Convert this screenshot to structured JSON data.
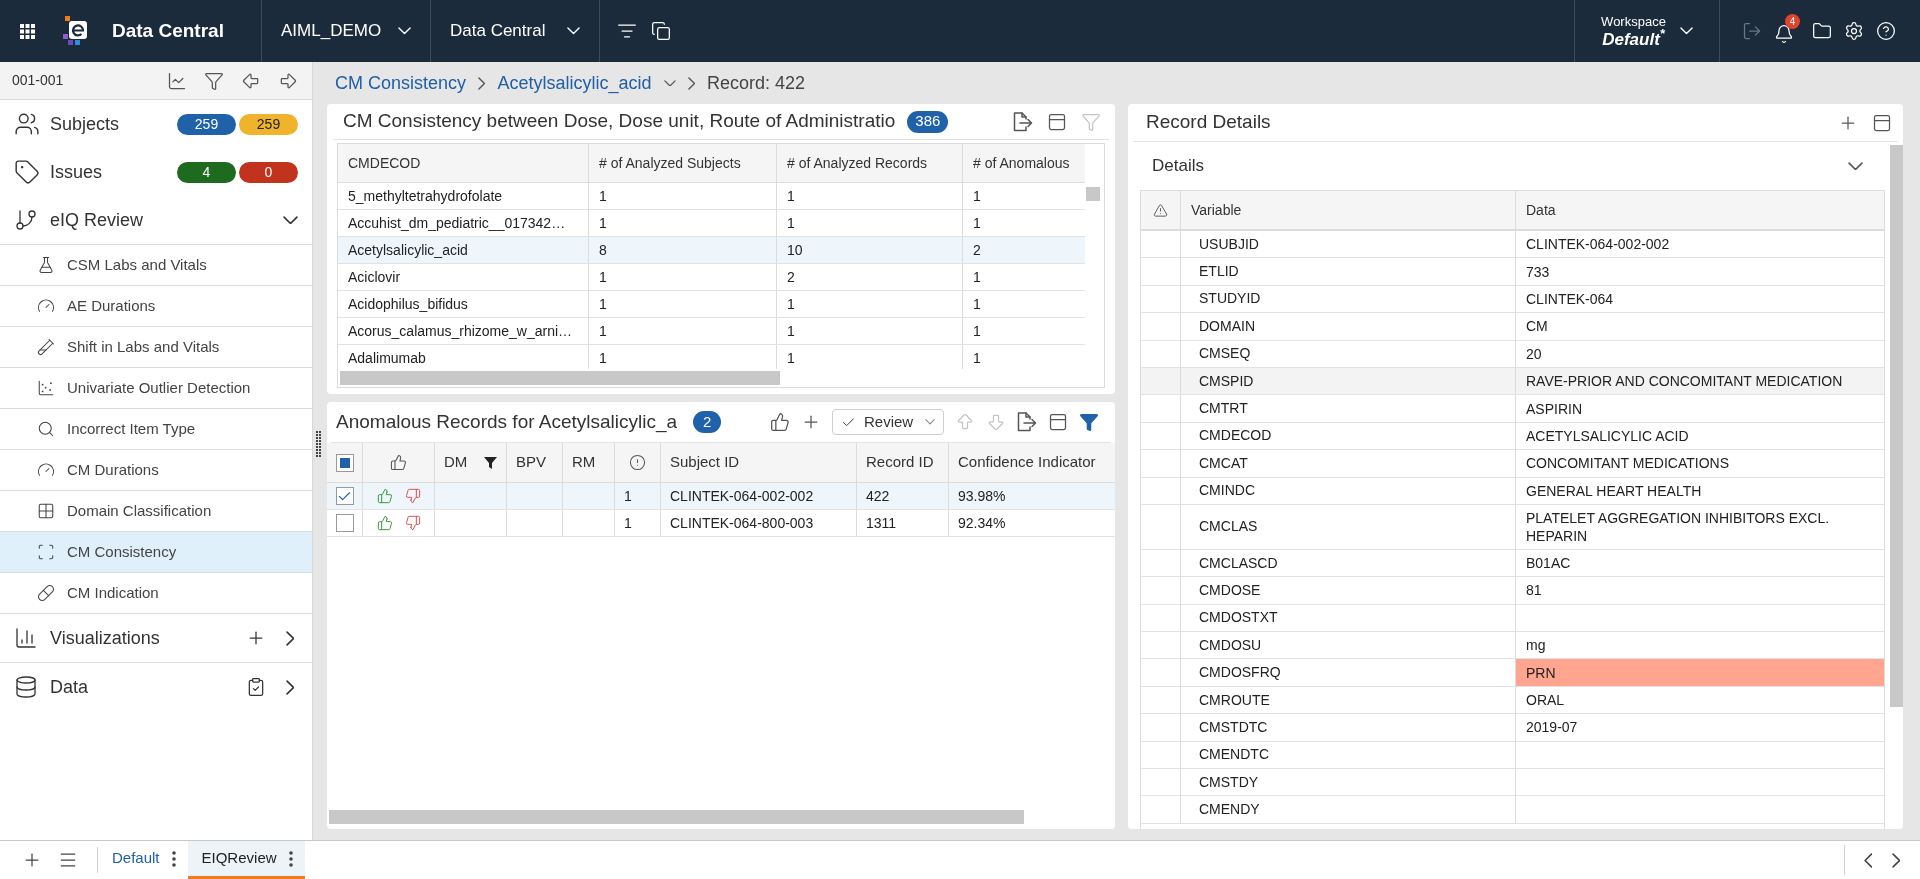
{
  "topbar": {
    "title": "Data Central",
    "menus": [
      {
        "label": "AIML_DEMO"
      },
      {
        "label": "Data Central"
      }
    ],
    "workspace": {
      "label": "Workspace",
      "value": "Default$^{*}$"
    },
    "export_disabled": true,
    "notification_count": "4"
  },
  "sidebar": {
    "header": "001-001",
    "counters": [
      {
        "label": "Subjects",
        "badges": [
          {
            "value": "259",
            "color": "#1f62aa"
          },
          {
            "value": "259",
            "color": "#f0b32c"
          }
        ]
      },
      {
        "label": "Issues",
        "badges": [
          {
            "value": "4",
            "color": "#1e6a1e"
          },
          {
            "value": "0",
            "color": "#c2331d"
          }
        ]
      }
    ],
    "sections": [
      {
        "label": "eIQ Review",
        "expanded": true,
        "children": [
          {
            "label": "CSM Labs and Vitals",
            "selected": false
          },
          {
            "label": "AE Durations",
            "selected": false
          },
          {
            "label": "Shift in Labs and Vitals",
            "selected": false
          },
          {
            "label": "Univariate Outlier Detection",
            "selected": false
          },
          {
            "label": "Incorrect Item Type",
            "selected": false
          },
          {
            "label": "CM Durations",
            "selected": false
          },
          {
            "label": "Domain Classification",
            "selected": false
          },
          {
            "label": "CM Consistency",
            "selected": true
          },
          {
            "label": "CM Indication",
            "selected": false
          }
        ]
      },
      {
        "label": "Visualizations",
        "expanded": false
      },
      {
        "label": "Data",
        "expanded": false
      }
    ]
  },
  "breadcrumb": [
    {
      "kind": "link",
      "label": "CM Consistency"
    },
    {
      "kind": "dropdown",
      "label": "Acetylsalicylic_acid"
    },
    {
      "kind": "current",
      "label": "Record: 422"
    }
  ],
  "consistency_panel": {
    "title": "CM Consistency between Dose, Dose unit, Route of Administratio",
    "count": "386",
    "filter_active": false,
    "columns": [
      "CMDECOD",
      "# of Analyzed Subjects",
      "# of Analyzed Records",
      "# of Anomalous"
    ],
    "rows": [
      {
        "cells": [
          "5_methyltetrahydrofolate",
          "1",
          "1",
          "1"
        ],
        "selected": false
      },
      {
        "cells": [
          "Accuhist_dm_pediatric__017342…",
          "1",
          "1",
          "1"
        ],
        "selected": false
      },
      {
        "cells": [
          "Acetylsalicylic_acid",
          "8",
          "10",
          "2"
        ],
        "selected": true
      },
      {
        "cells": [
          "Aciclovir",
          "1",
          "2",
          "1"
        ],
        "selected": false
      },
      {
        "cells": [
          "Acidophilus_bifidus",
          "1",
          "1",
          "1"
        ],
        "selected": false
      },
      {
        "cells": [
          "Acorus_calamus_rhizome_w_arni…",
          "1",
          "1",
          "1"
        ],
        "selected": false
      },
      {
        "cells": [
          "Adalimumab",
          "1",
          "1",
          "1"
        ],
        "selected": false
      }
    ]
  },
  "anomalous_panel": {
    "title": "Anomalous Records for Acetylsalicylic_a",
    "count": "2",
    "review_button": "Review",
    "move_up_disabled": true,
    "move_down_disabled": true,
    "filter_active": true,
    "columns": [
      {
        "kind": "checkbox",
        "indeterminate": true
      },
      {
        "kind": "vote"
      },
      {
        "kind": "text",
        "label": "DM",
        "filtered": true
      },
      {
        "kind": "text",
        "label": "BPV",
        "filtered": false
      },
      {
        "kind": "text",
        "label": "RM",
        "filtered": false
      },
      {
        "kind": "flag"
      },
      {
        "kind": "text",
        "label": "Subject ID",
        "filtered": false
      },
      {
        "kind": "text",
        "label": "Record ID",
        "filtered": false
      },
      {
        "kind": "text",
        "label": "Confidence Indicator",
        "filtered": false
      }
    ],
    "rows": [
      {
        "checked": true,
        "selected": true,
        "flag_count": "1",
        "subject_id": "CLINTEK-064-002-002",
        "record_id": "422",
        "confidence": "93.98%"
      },
      {
        "checked": false,
        "selected": false,
        "flag_count": "1",
        "subject_id": "CLINTEK-064-800-003",
        "record_id": "1311",
        "confidence": "92.34%"
      }
    ]
  },
  "record_details": {
    "title": "Record Details",
    "section": {
      "label": "Details",
      "expanded": true
    },
    "columns": [
      "Variable",
      "Data"
    ],
    "rows": [
      {
        "variable": "USUBJID",
        "data": "CLINTEK-064-002-002",
        "hovered": false,
        "flagged": false
      },
      {
        "variable": "ETLID",
        "data": "733",
        "hovered": false,
        "flagged": false
      },
      {
        "variable": "STUDYID",
        "data": "CLINTEK-064",
        "hovered": false,
        "flagged": false
      },
      {
        "variable": "DOMAIN",
        "data": "CM",
        "hovered": false,
        "flagged": false
      },
      {
        "variable": "CMSEQ",
        "data": "20",
        "hovered": false,
        "flagged": false
      },
      {
        "variable": "CMSPID",
        "data": "RAVE-PRIOR AND CONCOMITANT MEDICATION",
        "hovered": true,
        "flagged": false
      },
      {
        "variable": "CMTRT",
        "data": "ASPIRIN",
        "hovered": false,
        "flagged": false
      },
      {
        "variable": "CMDECOD",
        "data": "ACETYLSALICYLIC ACID",
        "hovered": false,
        "flagged": false
      },
      {
        "variable": "CMCAT",
        "data": "CONCOMITANT MEDICATIONS",
        "hovered": false,
        "flagged": false
      },
      {
        "variable": "CMINDC",
        "data": "GENERAL HEART HEALTH",
        "hovered": false,
        "flagged": false
      },
      {
        "variable": "CMCLAS",
        "data": "PLATELET AGGREGATION INHIBITORS EXCL. HEPARIN",
        "hovered": false,
        "flagged": false
      },
      {
        "variable": "CMCLASCD",
        "data": "B01AC",
        "hovered": false,
        "flagged": false
      },
      {
        "variable": "CMDOSE",
        "data": "81",
        "hovered": false,
        "flagged": false
      },
      {
        "variable": "CMDOSTXT",
        "hovered": false,
        "flagged": false
      },
      {
        "variable": "CMDOSU",
        "data": "mg",
        "hovered": false,
        "flagged": false
      },
      {
        "variable": "CMDOSFRQ",
        "data": "PRN",
        "hovered": false,
        "flagged": true
      },
      {
        "variable": "CMROUTE",
        "data": "ORAL",
        "hovered": false,
        "flagged": false
      },
      {
        "variable": "CMSTDTC",
        "data": "2019-07",
        "hovered": false,
        "flagged": false
      },
      {
        "variable": "CMENDTC",
        "hovered": false,
        "flagged": false
      },
      {
        "variable": "CMSTDY",
        "hovered": false,
        "flagged": false
      },
      {
        "variable": "CMENDY",
        "hovered": false,
        "flagged": false
      }
    ]
  },
  "footer": {
    "tabs": [
      {
        "label": "Default",
        "selected": false
      },
      {
        "label": "EIQReview",
        "selected": true
      }
    ]
  }
}
